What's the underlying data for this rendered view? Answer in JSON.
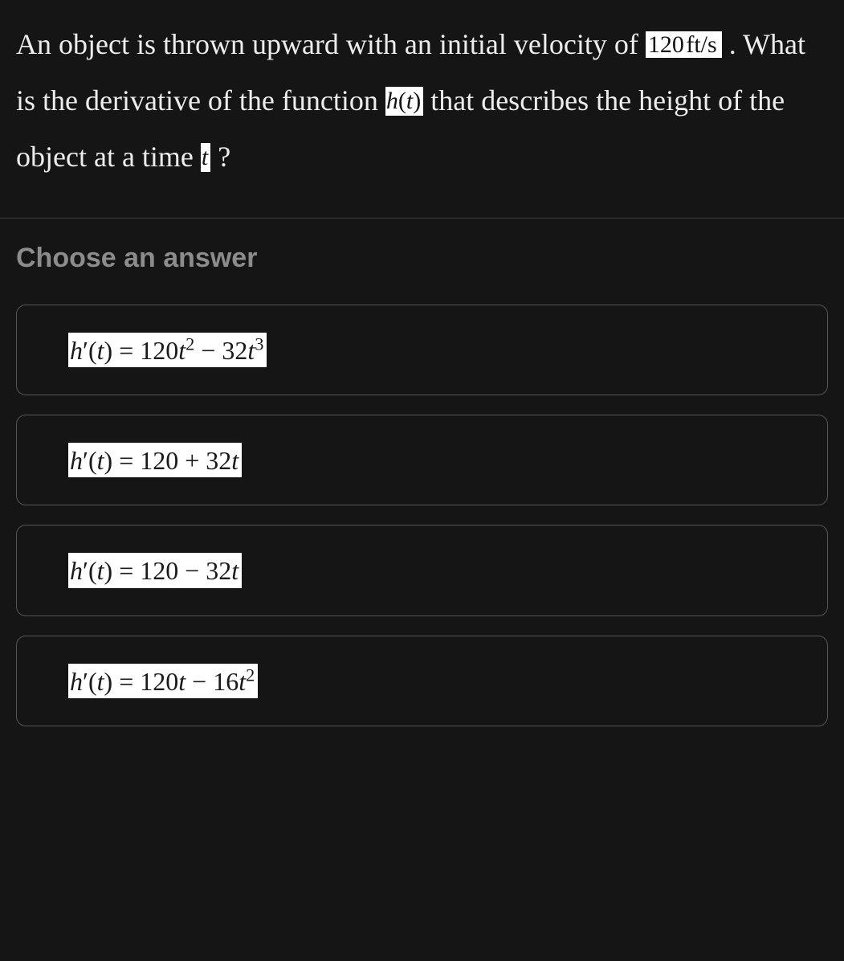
{
  "question": {
    "text_prefix": "An object is thrown upward with an initial velocity of ",
    "velocity_value": "120 ft/s",
    "text_mid1": " . What is the derivative of the function ",
    "height_fn": "h(t)",
    "text_mid2": " that describes the height of the object at a time ",
    "time_var": "t",
    "text_suffix": " ?"
  },
  "choose_label": "Choose an answer",
  "options": [
    {
      "id": "opt-a",
      "expr": "h'(t) = 120t^2 − 32t^3"
    },
    {
      "id": "opt-b",
      "expr": "h'(t) = 120 + 32t"
    },
    {
      "id": "opt-c",
      "expr": "h'(t) = 120 − 32t"
    },
    {
      "id": "opt-d",
      "expr": "h'(t) = 120t − 16t^2"
    }
  ]
}
